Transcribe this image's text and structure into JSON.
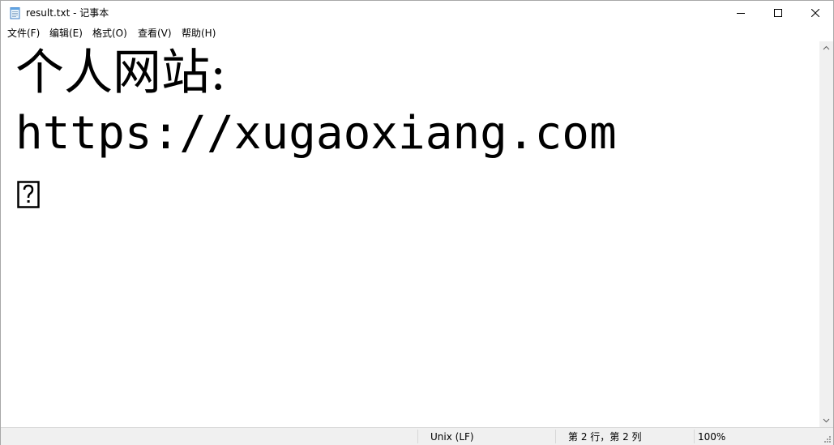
{
  "window": {
    "title": "result.txt - 记事本",
    "icon": "notepad-icon"
  },
  "titlebar_controls": {
    "minimize": "minimize-icon",
    "maximize": "maximize-icon",
    "close": "close-icon"
  },
  "menu": {
    "items": [
      {
        "label": "文件(F)"
      },
      {
        "label": "编辑(E)"
      },
      {
        "label": "格式(O)"
      },
      {
        "label": "查看(V)"
      },
      {
        "label": "帮助(H)"
      }
    ]
  },
  "document": {
    "lines": [
      "个人网站:",
      "https://xugaoxiang.com"
    ],
    "unknown_glyph": "missing-character-box"
  },
  "statusbar": {
    "encoding": "Unix (LF)",
    "position": "第 2 行，第 2 列",
    "zoom": "100%"
  }
}
